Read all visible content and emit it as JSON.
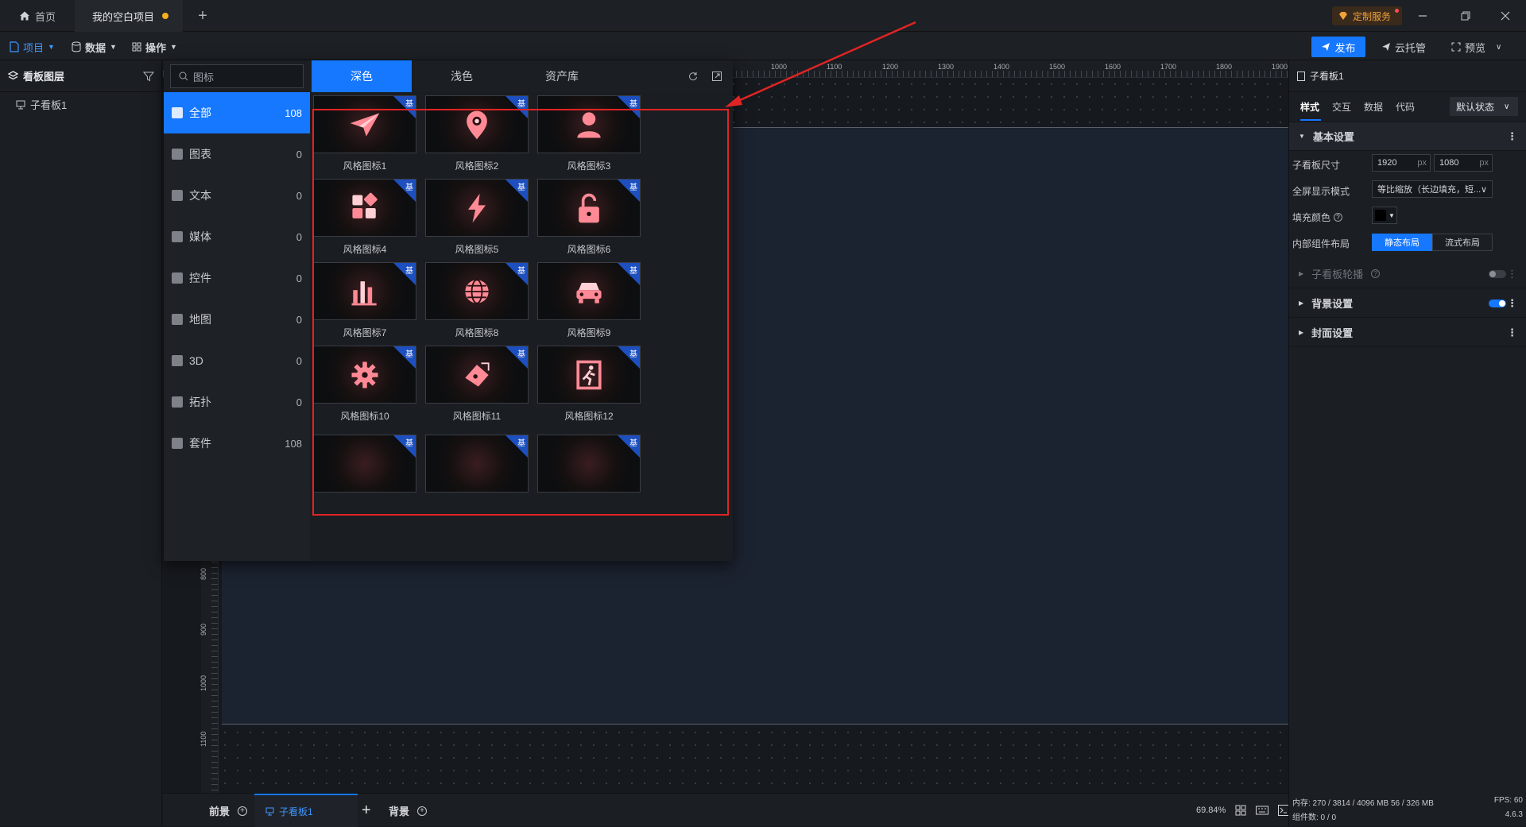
{
  "titlebar": {
    "home_label": "首页",
    "project_tab_label": "我的空白项目",
    "custom_service_label": "定制服务"
  },
  "toolbar": {
    "project_label": "项目",
    "data_label": "数据",
    "ops_label": "操作",
    "publish_label": "发布",
    "cloud_label": "云托管",
    "preview_label": "预览"
  },
  "left_panel": {
    "title": "看板图层",
    "layer_item": "子看板1"
  },
  "popup": {
    "search_placeholder": "图标",
    "tabs": [
      "深色",
      "浅色",
      "资产库"
    ],
    "active_tab": "深色",
    "categories": [
      {
        "label": "全部",
        "count": "108"
      },
      {
        "label": "图表",
        "count": "0"
      },
      {
        "label": "文本",
        "count": "0"
      },
      {
        "label": "媒体",
        "count": "0"
      },
      {
        "label": "控件",
        "count": "0"
      },
      {
        "label": "地图",
        "count": "0"
      },
      {
        "label": "3D",
        "count": "0"
      },
      {
        "label": "拓扑",
        "count": "0"
      },
      {
        "label": "套件",
        "count": "108"
      }
    ],
    "badge_text": "基",
    "icons": [
      {
        "label": "风格图标1",
        "icon": "paper-plane-icon"
      },
      {
        "label": "风格图标2",
        "icon": "location-pin-icon"
      },
      {
        "label": "风格图标3",
        "icon": "user-icon"
      },
      {
        "label": "风格图标4",
        "icon": "apps-icon"
      },
      {
        "label": "风格图标5",
        "icon": "lightning-icon"
      },
      {
        "label": "风格图标6",
        "icon": "unlock-icon"
      },
      {
        "label": "风格图标7",
        "icon": "bar-chart-icon"
      },
      {
        "label": "风格图标8",
        "icon": "globe-icon"
      },
      {
        "label": "风格图标9",
        "icon": "car-icon"
      },
      {
        "label": "风格图标10",
        "icon": "gear-icon"
      },
      {
        "label": "风格图标11",
        "icon": "satellite-icon"
      },
      {
        "label": "风格图标12",
        "icon": "exit-icon"
      }
    ]
  },
  "ruler": {
    "top_ticks": [
      "1000",
      "1100",
      "1200",
      "1300",
      "1400",
      "1500",
      "1600",
      "1700",
      "1800",
      "1900"
    ],
    "left_ticks": [
      "800",
      "900",
      "1000",
      "1100"
    ]
  },
  "right_panel": {
    "title": "子看板1",
    "tabs": [
      "样式",
      "交互",
      "数据",
      "代码"
    ],
    "state_select": "默认状态",
    "basic_section": "基本设置",
    "size_label": "子看板尺寸",
    "width_value": "1920",
    "height_value": "1080",
    "unit": "px",
    "fullscreen_label": "全屏显示模式",
    "fullscreen_value": "等比缩放（长边填充，短...",
    "fill_color_label": "填充颜色",
    "layout_label": "内部组件布局",
    "layout_static": "静态布局",
    "layout_flow": "流式布局",
    "carousel_section": "子看板轮播",
    "bg_section": "背景设置",
    "cover_section": "封面设置",
    "memory_text": "内存: 270 / 3814 / 4096 MB  56 / 326 MB",
    "fps_text": "FPS: 60",
    "component_count": "组件数: 0 / 0",
    "version": "4.6.3"
  },
  "bottom_bar": {
    "front_label": "前景",
    "board_tab": "子看板1",
    "bg_label": "背景",
    "zoom": "69.84%"
  },
  "colors": {
    "accent": "#1677ff",
    "highlight_red": "#e02424",
    "badge_blue": "#1d4fbf",
    "icon_pink": "#ff6b78"
  }
}
